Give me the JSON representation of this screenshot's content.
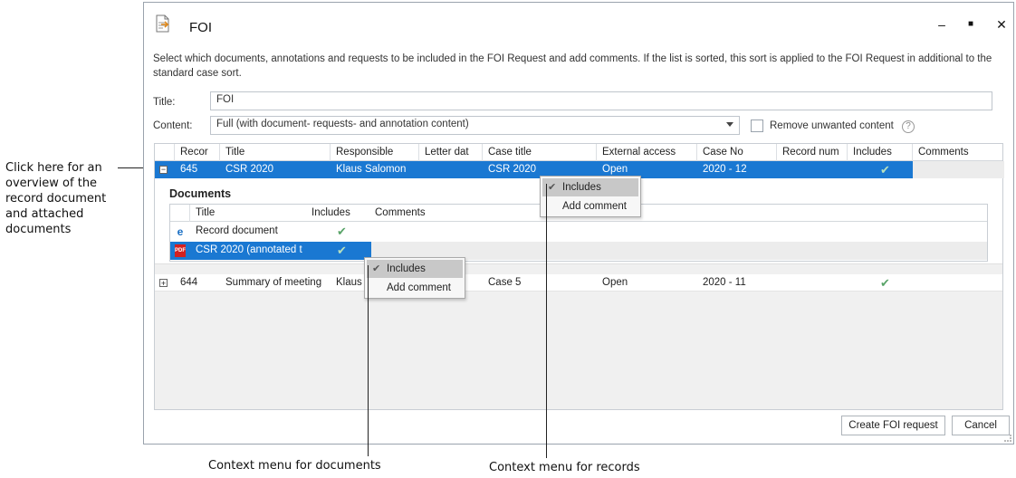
{
  "window": {
    "title": "FOI",
    "description": "Select which documents, annotations and requests to be included in the FOI Request and add comments. If the list is sorted, this sort is applied to the FOI Request in additional to the standard case sort.",
    "title_label": "Title:",
    "title_value": "FOI",
    "content_label": "Content:",
    "content_value": "Full (with document- requests- and annotation content)",
    "remove_unwanted_label": "Remove unwanted content",
    "minimize": "‒",
    "maximize": "■",
    "close": "✕"
  },
  "grid": {
    "columns": [
      "Recor",
      "Title",
      "Responsible",
      "Letter dat",
      "Case title",
      "External access",
      "Case No",
      "Record num",
      "Includes",
      "Comments"
    ],
    "rows": [
      {
        "expander": "−",
        "record": "645",
        "title": "CSR 2020",
        "responsible": "Klaus Salomon",
        "letter_date": "",
        "case_title": "CSR 2020",
        "external_access": "Open",
        "case_no": "2020 - 12",
        "record_num": "",
        "includes": "✔",
        "comments": ""
      },
      {
        "expander": "+",
        "record": "644",
        "title": "Summary of meeting",
        "responsible": "Klaus",
        "letter_date": "",
        "case_title": "Case 5",
        "external_access": "Open",
        "case_no": "2020 - 11",
        "record_num": "",
        "includes": "✔",
        "comments": ""
      }
    ]
  },
  "documents": {
    "heading": "Documents",
    "columns": [
      "Title",
      "Includes",
      "Comments"
    ],
    "rows": [
      {
        "icon": "e",
        "title": "Record document",
        "includes": "✔",
        "comments": ""
      },
      {
        "icon": "PDF",
        "title": "CSR 2020 (annotated t",
        "includes": "✔",
        "comments": ""
      }
    ]
  },
  "record_menu": {
    "items": [
      "Includes",
      "Add comment"
    ],
    "check": "✔"
  },
  "document_menu": {
    "items": [
      "Includes",
      "Add comment"
    ],
    "check": "✔"
  },
  "buttons": {
    "create": "Create FOI request",
    "cancel": "Cancel"
  },
  "callouts": {
    "left": "Click here for an overview of the record document and attached documents",
    "documents_menu": "Context menu for documents",
    "records_menu": "Context menu for records"
  },
  "colors": {
    "selection": "#1a78d2",
    "check": "#5aa469",
    "menu_highlight": "#c8c8c8"
  }
}
